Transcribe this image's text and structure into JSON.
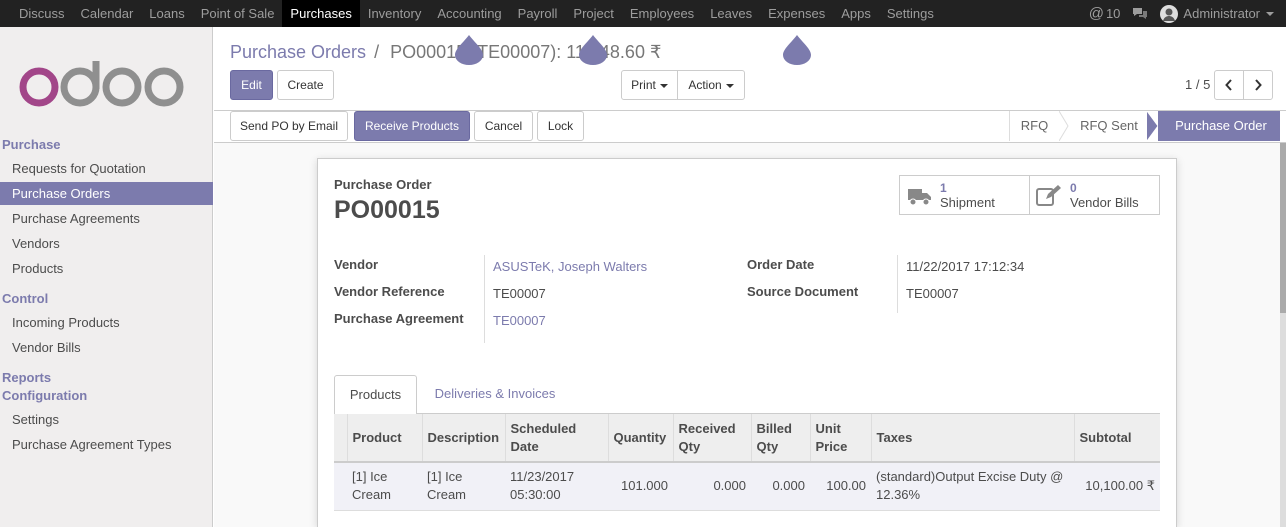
{
  "topbar": {
    "apps": [
      "Discuss",
      "Calendar",
      "Loans",
      "Point of Sale",
      "Purchases",
      "Inventory",
      "Accounting",
      "Payroll",
      "Project",
      "Employees",
      "Leaves",
      "Expenses",
      "Apps",
      "Settings"
    ],
    "active_app": "Purchases",
    "mentions_count": "10",
    "user": "Administrator"
  },
  "sidebar": {
    "brand": "odoo",
    "sections": [
      {
        "title": "Purchase",
        "items": [
          "Requests for Quotation",
          "Purchase Orders",
          "Purchase Agreements",
          "Vendors",
          "Products"
        ]
      },
      {
        "title": "Control",
        "items": [
          "Incoming Products",
          "Vendor Bills"
        ]
      },
      {
        "title": "Reports",
        "items": []
      },
      {
        "title": "Configuration",
        "items": [
          "Settings",
          "Purchase Agreement Types"
        ]
      }
    ],
    "active_item": "Purchase Orders"
  },
  "control_panel": {
    "breadcrumb_parent": "Purchase Orders",
    "breadcrumb_sep": "/",
    "breadcrumb_current": "PO00015 (TE00007): 11,448.60 ₹",
    "edit_label": "Edit",
    "create_label": "Create",
    "print_label": "Print",
    "action_label": "Action",
    "pager": "1 / 5"
  },
  "statusbar": {
    "buttons": [
      "Send PO by Email",
      "Receive Products",
      "Cancel",
      "Lock"
    ],
    "stages": [
      "RFQ",
      "RFQ Sent",
      "Purchase Order"
    ],
    "active_stage": "Purchase Order"
  },
  "form": {
    "doc_type": "Purchase Order",
    "name": "PO00015",
    "smart_buttons": [
      {
        "count": "1",
        "label": "Shipment",
        "icon": "truck-icon"
      },
      {
        "count": "0",
        "label": "Vendor Bills",
        "icon": "pencil-square-icon"
      }
    ],
    "left_fields": [
      {
        "label": "Vendor",
        "value": "ASUSTeK, Joseph Walters",
        "link": true
      },
      {
        "label": "Vendor Reference",
        "value": "TE00007",
        "link": false
      },
      {
        "label": "Purchase Agreement",
        "value": "TE00007",
        "link": true
      }
    ],
    "right_fields": [
      {
        "label": "Order Date",
        "value": "11/22/2017 17:12:34"
      },
      {
        "label": "Source Document",
        "value": "TE00007"
      }
    ],
    "tabs": [
      "Products",
      "Deliveries & Invoices"
    ],
    "active_tab": "Products",
    "columns": [
      "Product",
      "Description",
      "Scheduled Date",
      "Quantity",
      "Received Qty",
      "Billed Qty",
      "Unit Price",
      "Taxes",
      "Subtotal"
    ],
    "lines": [
      {
        "product": "[1] Ice Cream",
        "description": "[1] Ice Cream",
        "scheduled_date": "11/23/2017 05:30:00",
        "quantity": "101.000",
        "received_qty": "0.000",
        "billed_qty": "0.000",
        "unit_price": "100.00",
        "taxes": "(standard)Output Excise Duty @ 12.36%",
        "subtotal": "10,100.00 ₹"
      }
    ]
  },
  "colors": {
    "brand": "#7c7bad",
    "topbar": "#222222"
  }
}
